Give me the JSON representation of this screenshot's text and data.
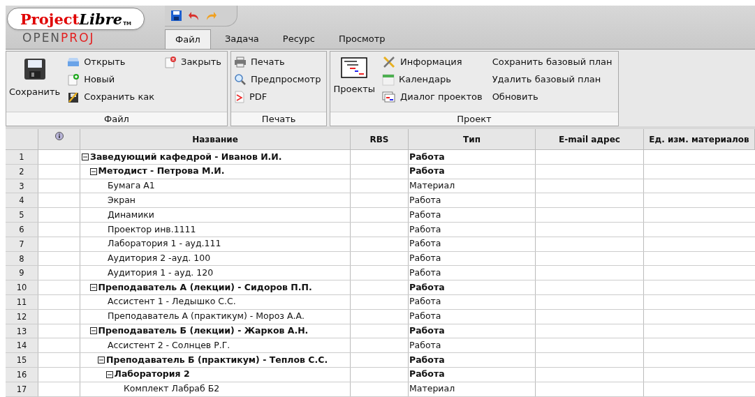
{
  "logo": {
    "part_1": "Project",
    "part_2": "Libre",
    "mark": "TM",
    "subtitle_1": "OPEN",
    "subtitle_2": "PROJ"
  },
  "tabs": [
    {
      "label": "Файл",
      "selected": true
    },
    {
      "label": "Задача",
      "selected": false
    },
    {
      "label": "Ресурс",
      "selected": false
    },
    {
      "label": "Просмотр",
      "selected": false
    }
  ],
  "ribbon": [
    {
      "label": "Файл",
      "large": "Сохранить",
      "columns": [
        [
          "Открыть",
          "Новый",
          "Сохранить как"
        ],
        [
          "Закрыть"
        ]
      ]
    },
    {
      "label": "Печать",
      "columns": [
        [
          "Печать",
          "Предпросмотр",
          "PDF"
        ]
      ]
    },
    {
      "label": "Проект",
      "large": "Проекты",
      "columns": [
        [
          "Информация",
          "Календарь",
          "Диалог проектов"
        ],
        [
          "Сохранить базовый план",
          "Удалить базовый план",
          "Обновить"
        ]
      ]
    }
  ],
  "table": {
    "columns": [
      "Название",
      "RBS",
      "Тип",
      "E-mail адрес",
      "Ед. изм. материалов"
    ],
    "rows": [
      {
        "number": "1",
        "name": "Заведующий кафедрой - Иванов И.И.",
        "type": "Работа",
        "expanded": true,
        "children": [
          {
            "number": "2",
            "name": "Методист - Петрова М.И.",
            "type": "Работа",
            "expanded": true,
            "children": [
              {
                "number": "3",
                "name": "Бумага А1",
                "type": "Материал"
              },
              {
                "number": "4",
                "name": "Экран",
                "type": "Работа"
              },
              {
                "number": "5",
                "name": "Динамики",
                "type": "Работа"
              },
              {
                "number": "6",
                "name": "Проектор инв.1111",
                "type": "Работа"
              },
              {
                "number": "7",
                "name": "Лаборатория 1 - ауд.111",
                "type": "Работа"
              },
              {
                "number": "8",
                "name": "Аудитория 2 -ауд. 100",
                "type": "Работа"
              },
              {
                "number": "9",
                "name": "Аудитория 1 - ауд. 120",
                "type": "Работа"
              }
            ]
          },
          {
            "number": "10",
            "name": "Преподаватель А (лекции) - Сидоров П.П.",
            "type": "Работа",
            "expanded": true,
            "children": [
              {
                "number": "11",
                "name": "Ассистент 1 - Ледышко С.С.",
                "type": "Работа"
              },
              {
                "number": "12",
                "name": "Преподаватель А (практикум) - Мороз А.А.",
                "type": "Работа"
              }
            ]
          },
          {
            "number": "13",
            "name": "Преподаватель Б (лекции) - Жарков А.Н.",
            "type": "Работа",
            "expanded": true,
            "children": [
              {
                "number": "14",
                "name": "Ассистент 2 - Солнцев Р.Г.",
                "type": "Работа"
              },
              {
                "number": "15",
                "name": "Преподаватель Б (практикум) - Теплов С.С.",
                "type": "Работа",
                "expanded": true,
                "children": [
                  {
                    "number": "16",
                    "name": "Лаборатория 2",
                    "type": "Работа",
                    "expanded": true,
                    "children": [
                      {
                        "number": "17",
                        "name": "Комплект Лабраб Б2",
                        "type": "Материал"
                      }
                    ]
                  }
                ]
              }
            ]
          }
        ]
      }
    ]
  }
}
